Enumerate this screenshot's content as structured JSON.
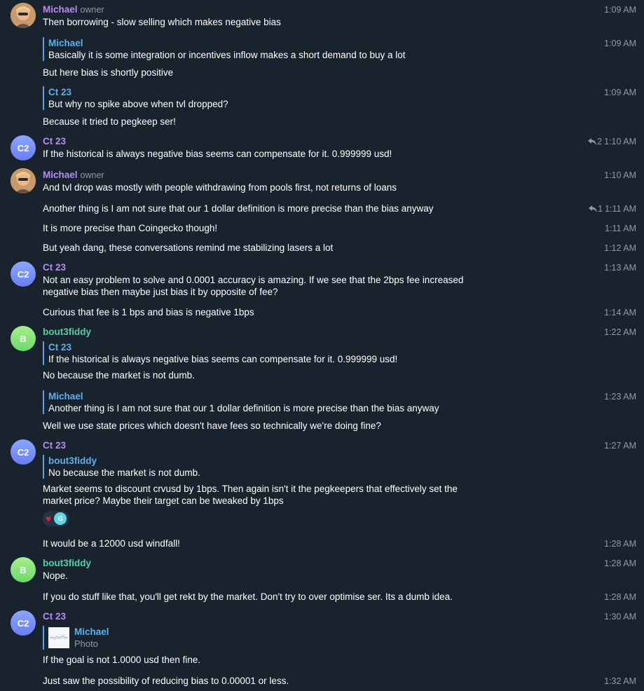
{
  "messages": [
    {
      "time": "1:09 AM",
      "sender": "Michael",
      "role": "owner",
      "text": "Then borrowing - slow selling which makes negative bias"
    },
    {
      "time": "1:09 AM",
      "quote_name": "Michael",
      "quote_text": "Basically it is some integration or incentives inflow makes a short demand to buy a lot",
      "text": "But here bias is shortly positive"
    },
    {
      "time": "1:09 AM",
      "quote_name": "Ct 23",
      "quote_text": "But why no spike above when tvl dropped?",
      "text": "Because it tried to pegkeep ser!"
    },
    {
      "time": "1:10 AM",
      "avatar": "C2",
      "sender": "Ct 23",
      "replies": "2",
      "text": "If the historical is always negative bias seems can compensate for it. 0.999999 usd!"
    },
    {
      "time": "1:10 AM",
      "sender": "Michael",
      "role": "owner",
      "text": "And tvl drop was mostly with people withdrawing from pools first, not returns of loans"
    },
    {
      "time": "1:11 AM",
      "replies": "1",
      "text": "Another thing is I am not sure that our 1 dollar definition is more precise than the bias anyway"
    },
    {
      "time": "1:11 AM",
      "text": "It is more precise than Coingecko though!"
    },
    {
      "time": "1:12 AM",
      "text": "But yeah dang, these conversations remind me stabilizing lasers a lot"
    },
    {
      "time": "1:13 AM",
      "avatar": "C2",
      "sender": "Ct 23",
      "text": "Not an easy problem to solve and 0.0001 accuracy is amazing. If we see that the 2bps fee increased negative bias then maybe just bias it by opposite of fee?"
    },
    {
      "time": "1:14 AM",
      "text": "Curious that fee is 1 bps and bias is negative 1bps"
    },
    {
      "time": "1:22 AM",
      "avatar": "B",
      "sender": "bout3fiddy",
      "quote_name": "Ct 23",
      "quote_text": "If the historical is always negative bias seems can compensate for it. 0.999999 usd!",
      "text": "No because the market is not dumb."
    },
    {
      "time": "1:23 AM",
      "quote_name": "Michael",
      "quote_text": "Another thing is I am not sure that our 1 dollar definition is more precise than the bias anyway",
      "text": "Well we use state prices which doesn't have fees so technically we're doing fine?"
    },
    {
      "time": "1:27 AM",
      "avatar": "C2",
      "sender": "Ct 23",
      "quote_name": "bout3fiddy",
      "quote_text": "No because the market is not dumb.",
      "text": "Market seems to discount crvusd by 1bps. Then again isn't it the pegkeepers that effectively set the market price? Maybe their target can be tweaked by 1bps",
      "reaction_avatar": "G"
    },
    {
      "time": "1:28 AM",
      "text": "It would be a 12000 usd windfall!"
    },
    {
      "time": "1:28 AM",
      "avatar": "B",
      "sender": "bout3fiddy",
      "text": "Nope."
    },
    {
      "time": "1:28 AM",
      "text": "If you do stuff like that, you'll get rekt by the market. Don't try to over optimise ser. Its a dumb idea."
    },
    {
      "time": "1:30 AM",
      "avatar": "C2",
      "sender": "Ct 23",
      "quote_name": "Michael",
      "quote_text": "Photo",
      "text": "If the goal is not 1.0000 usd then fine."
    },
    {
      "time": "1:32 AM",
      "text": "Just saw the possibility of reducing bias to 0.00001 or less."
    }
  ]
}
